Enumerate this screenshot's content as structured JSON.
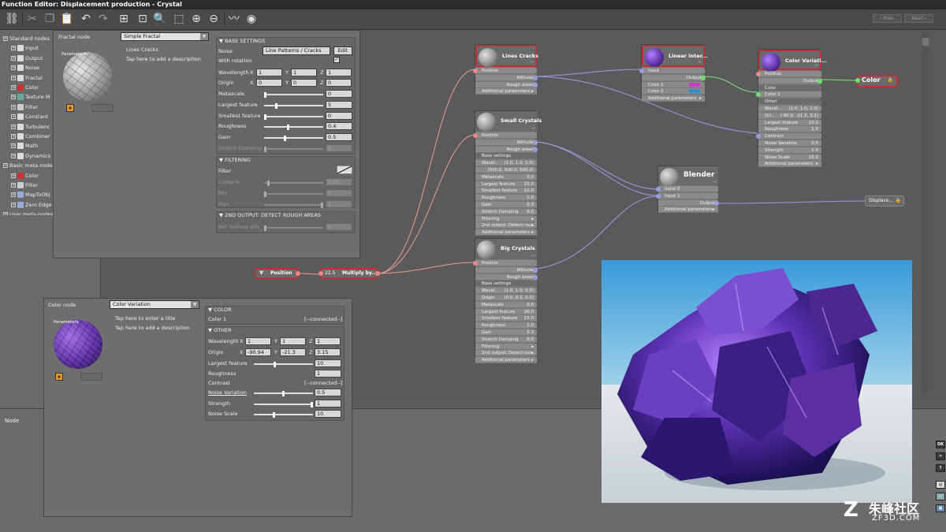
{
  "window": {
    "title": "Function Editor: Displacement production - Crystal"
  },
  "toolbar": {
    "prev_label": "‹ Prev.",
    "next_label": "Next ›"
  },
  "tree": {
    "items": [
      {
        "label": "Standard nodes"
      },
      {
        "label": "Input"
      },
      {
        "label": "Output"
      },
      {
        "label": "Noise"
      },
      {
        "label": "Fractal"
      },
      {
        "label": "Color"
      },
      {
        "label": "Texture M"
      },
      {
        "label": "Filter"
      },
      {
        "label": "Constant"
      },
      {
        "label": "Turbulenc"
      },
      {
        "label": "Combiner"
      },
      {
        "label": "Math"
      },
      {
        "label": "Dynamics"
      },
      {
        "label": "Basic meta-nodes"
      },
      {
        "label": "Color"
      },
      {
        "label": "Filter"
      },
      {
        "label": "MapToObj"
      },
      {
        "label": "Zero Edge"
      },
      {
        "label": "User meta-nodes"
      }
    ]
  },
  "fractal_panel": {
    "header": "Fractal node",
    "type_select": "Simple Fractal",
    "thumb_label": "Parameters",
    "title": "Lines Cracks",
    "description_hint": "Tap here to add a description",
    "base_settings_label": "BASE SETTINGS",
    "noise_label": "Noise",
    "noise_value": "Line Patterns / Cracks",
    "edit_label": "Edit",
    "with_rotation_label": "With rotation",
    "with_rotation_check": "✓",
    "wavelength_label": "Wavelength",
    "wavelength": {
      "x": "1",
      "y": "1",
      "z": "1"
    },
    "origin_label": "Origin",
    "origin": {
      "x": "0",
      "y": "0",
      "z": "0"
    },
    "rows": [
      {
        "label": "Metascale",
        "value": "0",
        "dim": false,
        "knob": 0.0
      },
      {
        "label": "Largest feature",
        "value": "5",
        "dim": false,
        "knob": 0.2
      },
      {
        "label": "Smallest feature",
        "value": "0",
        "dim": false,
        "knob": 0.0
      },
      {
        "label": "Roughness",
        "value": "0.4",
        "dim": false,
        "knob": 0.4
      },
      {
        "label": "Gain",
        "value": "0.5",
        "dim": false,
        "knob": 0.35
      },
      {
        "label": "Stretch Damping",
        "value": "0",
        "dim": true,
        "knob": 0.0
      }
    ],
    "filtering_label": "FILTERING",
    "filter_label": "Filter",
    "filter_rows": [
      {
        "label": "Creep in",
        "value": "0.05",
        "knob": 0.05
      },
      {
        "label": "Min",
        "value": "0",
        "knob": 0.0
      },
      {
        "label": "Max",
        "value": "1",
        "knob": 1.0
      }
    ],
    "second_output_label": "2ND OUTPUT: DETECT ROUGH AREAS",
    "ref_feature_label": "Ref. feature size",
    "ref_feature_value": "0"
  },
  "color_panel": {
    "header": "Color node",
    "type_select": "Color Variation",
    "thumb_label": "Parameters",
    "title_hint": "Tap here to enter a title",
    "description_hint": "Tap here to add a description",
    "color_section_label": "COLOR",
    "color1_label": "Color 1",
    "color1_value": "[--connected--]",
    "other_section_label": "OTHER",
    "wavelength_label": "Wavelength",
    "wavelength": {
      "x": "1",
      "y": "1",
      "z": "1"
    },
    "origin_label": "Origin",
    "origin": {
      "x": "-90.94",
      "y": "-21.3",
      "z": "3.15"
    },
    "largest_feature_label": "Largest feature",
    "largest_feature_value": "10",
    "roughness_label": "Roughness",
    "roughness_value": "1",
    "contrast_label": "Contrast",
    "contrast_value": "[--connected--]",
    "noise_variation_label": "Noise Variation",
    "noise_variation_value": "0.5",
    "strength_label": "Strength",
    "strength_value": "1",
    "noise_scale_label": "Noise Scale",
    "noise_scale_value": "10"
  },
  "bottom": {
    "node_label": "Node"
  },
  "right_strip": {
    "ok": "OK",
    "close": "✕",
    "help": "?"
  },
  "nodes": {
    "position": {
      "label": "Position"
    },
    "multiply": {
      "prefix": "22.5",
      "label": "Multiply by..."
    },
    "lines_cracks": {
      "title": "Lines Cracks",
      "rows": [
        {
          "l": "Position",
          "r": ""
        },
        {
          "l": "",
          "r": "Altitude"
        },
        {
          "l": "",
          "r": "Rough areas"
        },
        {
          "l": "Additional parameters",
          "r": "▸"
        }
      ]
    },
    "small_crystals": {
      "title": "Small Crystals",
      "rows": [
        {
          "l": "Position",
          "r": ""
        },
        {
          "l": "",
          "r": "Altitude"
        },
        {
          "l": "",
          "r": "Rough areas"
        },
        {
          "l": "Base settings",
          "r": ""
        },
        {
          "l": "Wavel...",
          "r": "(1.0, 1.0, 1.0)"
        },
        {
          "l": "",
          "r": "(500.0, 500.0, 500.0)"
        },
        {
          "l": "Metascale",
          "r": "0.0"
        },
        {
          "l": "Largest feature",
          "r": "15.0"
        },
        {
          "l": "Smallest feature",
          "r": "10.0"
        },
        {
          "l": "Roughness",
          "r": "1.0"
        },
        {
          "l": "Gain",
          "r": "0.3"
        },
        {
          "l": "Stretch Damping",
          "r": "0.0"
        },
        {
          "l": "Filtering",
          "r": "▸"
        },
        {
          "l": "2nd output: Detect rou...",
          "r": "▸"
        },
        {
          "l": "Additional parameters",
          "r": "▸"
        }
      ]
    },
    "big_crystals": {
      "title": "Big Crystals",
      "rows": [
        {
          "l": "Position",
          "r": ""
        },
        {
          "l": "",
          "r": "Altitude"
        },
        {
          "l": "",
          "r": "Rough areas"
        },
        {
          "l": "Base settings",
          "r": ""
        },
        {
          "l": "Wavel...",
          "r": "(1.0, 1.0, 1.0)"
        },
        {
          "l": "Origin",
          "r": "(0.0, 0.0, 0.0)"
        },
        {
          "l": "Metascale",
          "r": "0.0"
        },
        {
          "l": "Largest feature",
          "r": "20.0"
        },
        {
          "l": "Smallest feature",
          "r": "15.0"
        },
        {
          "l": "Roughness",
          "r": "1.0"
        },
        {
          "l": "Gain",
          "r": "0.3"
        },
        {
          "l": "Stretch Damping",
          "r": "0.0"
        },
        {
          "l": "Filtering",
          "r": "▸"
        },
        {
          "l": "2nd output: Detect rou...",
          "r": "▸"
        },
        {
          "l": "Additional parameters",
          "r": "▸"
        }
      ]
    },
    "linear_inter": {
      "title": "Linear Inter...",
      "rows": [
        {
          "l": "Input",
          "r": ""
        },
        {
          "l": "",
          "r": "Output"
        },
        {
          "l": "Color 1",
          "r": ""
        },
        {
          "l": "Color 2",
          "r": ""
        },
        {
          "l": "Additional parameters",
          "r": "▸"
        }
      ],
      "color1": "#c040c0",
      "color2": "#3a8ad0"
    },
    "blender": {
      "title": "Blender",
      "rows": [
        {
          "l": "Input 0",
          "r": ""
        },
        {
          "l": "Input 1",
          "r": ""
        },
        {
          "l": "",
          "r": "Output"
        },
        {
          "l": "Additional parameters",
          "r": "▸"
        }
      ]
    },
    "color_variation": {
      "title": "Color Variati...",
      "rows": [
        {
          "l": "Position",
          "r": ""
        },
        {
          "l": "",
          "r": "Output"
        },
        {
          "l": "Color",
          "r": ""
        },
        {
          "l": "Color 1",
          "r": ""
        },
        {
          "l": "Other",
          "r": ""
        },
        {
          "l": "Wavel...",
          "r": "(1.0, 1.0, 1.0)"
        },
        {
          "l": "Ori...",
          "r": "(-90.9, -21.3, 3.1)"
        },
        {
          "l": "Largest feature",
          "r": "10.0"
        },
        {
          "l": "Roughness",
          "r": "1.0"
        },
        {
          "l": "Contrast",
          "r": ""
        },
        {
          "l": "Noise Variation",
          "r": "0.5"
        },
        {
          "l": "Strength",
          "r": "1.0"
        },
        {
          "l": "Noise Scale",
          "r": "10.0"
        },
        {
          "l": "Additional parameters",
          "r": "▸"
        }
      ]
    },
    "color_out": {
      "label": "Color"
    },
    "displace_out": {
      "label": "Displace..."
    }
  },
  "watermark": {
    "cn": "朱峰社区",
    "en": "ZF3D.COM"
  },
  "colors": {
    "accent_red": "#c0303a",
    "link_pink": "#e89a9a",
    "link_purple": "#9a9ae0",
    "link_green": "#7ee07e",
    "crystal_purple": "#5a30a0"
  }
}
